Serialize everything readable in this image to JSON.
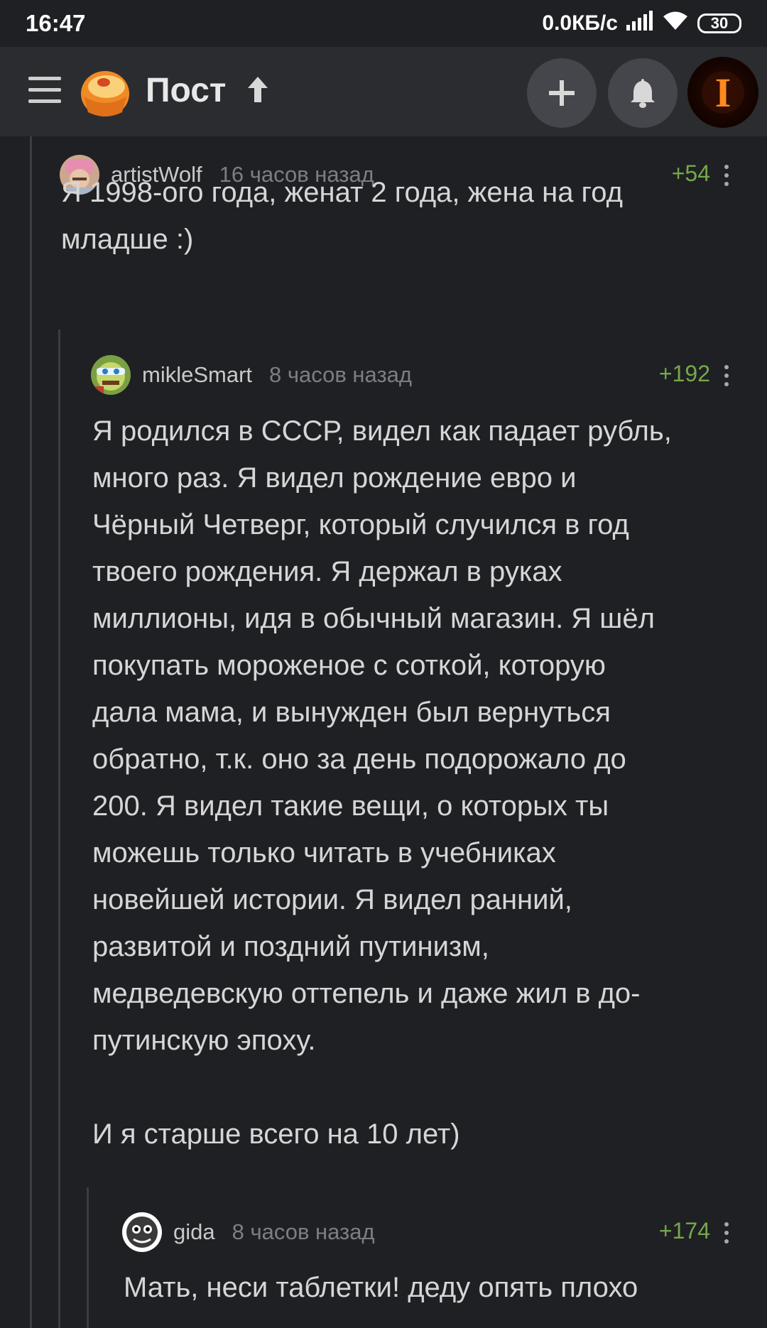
{
  "status_bar": {
    "time": "16:47",
    "network_speed": "0.0КБ/с",
    "battery": "30",
    "icons": [
      "signal-icon",
      "wifi-icon",
      "battery-icon"
    ]
  },
  "app_bar": {
    "title": "Пост",
    "menu_icon": "menu-icon",
    "logo_icon": "pikabu-logo",
    "up_icon": "arrow-up-icon",
    "add_icon": "plus-icon",
    "bell_icon": "bell-icon",
    "avatar_letter": "I"
  },
  "comments": [
    {
      "user": "artistWolf",
      "time": "16 часов назад",
      "score": "+54",
      "lines": [
        "Я 1998-ого года, женат 2 года, жена на год",
        "младше :)"
      ]
    },
    {
      "user": "mikleSmart",
      "time": "8 часов назад",
      "score": "+192",
      "lines": [
        "Я родился в СССР, видел как падает рубль,",
        "много раз. Я видел рождение евро и",
        "Чёрный Четверг, который случился в год",
        "твоего рождения. Я держал в руках",
        "миллионы, идя в обычный магазин. Я шёл",
        "покупать мороженое с соткой, которую",
        "дала мама, и вынужден был вернуться",
        "обратно, т.к. оно за день подорожало до",
        "200. Я видел такие вещи, о которых ты",
        "можешь только читать в учебниках",
        "новейшей истории. Я видел ранний,",
        "развитой и поздний путинизм,",
        "медведевскую оттепель и даже жил в до-",
        "путинскую эпоху."
      ],
      "extra_line": "И я старше всего на 10 лет)"
    },
    {
      "user": "gida",
      "time": "8 часов назад",
      "score": "+174",
      "lines": [
        "Мать, неси таблетки! деду опять плохо"
      ]
    }
  ],
  "colors": {
    "background": "#1f2023",
    "app_bar": "#2b2c30",
    "score": "#75a84a",
    "text": "#d6d6d6",
    "muted": "#7d7e83"
  }
}
